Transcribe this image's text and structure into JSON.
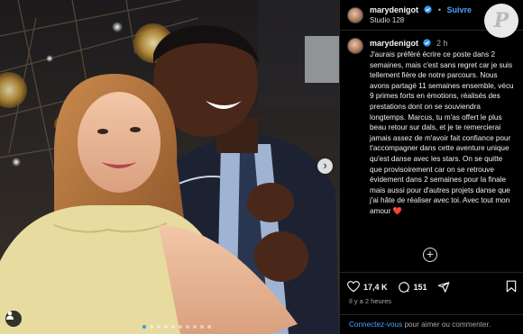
{
  "post": {
    "username": "marydenigot",
    "separator": "•",
    "follow_label": "Suivre",
    "location": "Studio 128",
    "caption_time": "2 h",
    "caption_text": "J'aurais préféré écrire ce poste dans 2 semaines, mais c'est sans regret car je suis tellement fière de notre parcours. Nous avons partagé 11 semaines ensemble, vécu 9 primes forts en émotions, réalisés des prestations dont on se souviendra longtemps. Marcus, tu m'as offert le plus beau retour sur dals, et je te remercierai jamais assez de m'avoir fait confiance pour t'accompagner dans cette aventure unique qu'est danse avec les stars. On se quitte que provisoirement car on se retrouve évidement dans 2 semaines pour la finale mais aussi pour d'autres projets danse que j'ai hâte de réaliser avec toi. Avec tout mon amour ❤️",
    "likes": "17,4 K",
    "comments": "151",
    "posted_ago": "Il y a 2 heures"
  },
  "login": {
    "link_label": "Connectez-vous",
    "rest": " pour aimer ou commenter."
  },
  "watermark": {
    "letter": "P"
  },
  "carousel": {
    "dot_count": 10,
    "active_index": 0
  },
  "icons": {
    "verified": "verified-badge-icon",
    "like": "heart-icon",
    "comment": "comment-bubble-icon",
    "share": "paper-plane-icon",
    "save": "bookmark-icon",
    "add": "plus-circle-icon",
    "next": "chevron-right-icon",
    "tag": "person-icon"
  },
  "colors": {
    "link_blue": "#4aa3ff",
    "carousel_active": "#3897f0",
    "heart_red": "#ff3040",
    "background": "#000000"
  }
}
